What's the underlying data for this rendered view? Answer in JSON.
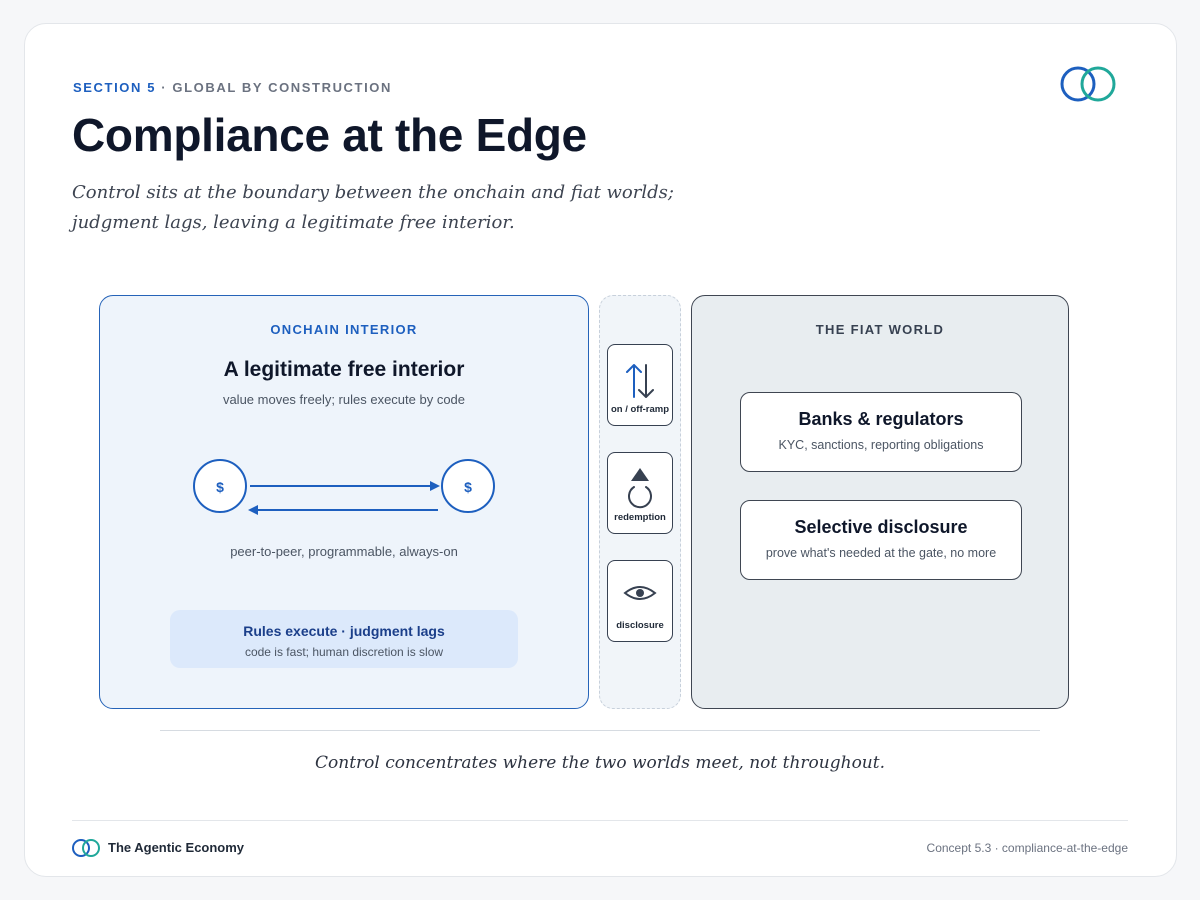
{
  "header": {
    "section_number": "SECTION 5",
    "separator": " · ",
    "section_name": "GLOBAL BY CONSTRUCTION",
    "title": "Compliance at the Edge",
    "subtitle_line1": "Control sits at the boundary between the onchain and fiat worlds;",
    "subtitle_line2": "judgment lags, leaving a legitimate free interior."
  },
  "onchain": {
    "label": "ONCHAIN INTERIOR",
    "heading": "A legitimate free interior",
    "subheading": "value moves freely; rules execute by code",
    "coin_left": "$",
    "coin_right": "$",
    "flow_caption": "peer-to-peer, programmable, always-on",
    "rules_title": "Rules execute · judgment lags",
    "rules_sub": "code is fast; human discretion is slow"
  },
  "gates": [
    {
      "label": "on / off-ramp",
      "icon": "up-down-arrows-icon"
    },
    {
      "label": "redemption",
      "icon": "redemption-cycle-icon"
    },
    {
      "label": "disclosure",
      "icon": "eye-icon"
    }
  ],
  "fiat": {
    "label": "THE FIAT WORLD",
    "boxes": [
      {
        "title": "Banks & regulators",
        "sub": "KYC, sanctions, reporting obligations"
      },
      {
        "title": "Selective disclosure",
        "sub": "prove what's needed at the gate, no more"
      }
    ]
  },
  "conclusion": "Control concentrates where the two worlds meet, not throughout.",
  "footer": {
    "brand": "The Agentic Economy",
    "concept": "Concept 5.3 · compliance-at-the-edge"
  },
  "colors": {
    "accent_blue": "#1d5fbf",
    "accent_teal": "#20a89a",
    "dark": "#0f172a",
    "onchain_bg": "#eef4fb",
    "fiat_bg": "#e8edf0"
  }
}
